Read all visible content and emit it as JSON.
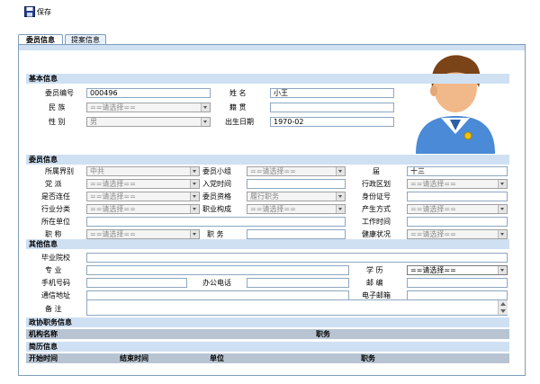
{
  "toolbar": {
    "save_label": "保存"
  },
  "tabs": [
    {
      "label": "委员信息"
    },
    {
      "label": "提案信息"
    }
  ],
  "basic": {
    "title": "基本信息",
    "member_no_label": "委员编号",
    "member_no": "000496",
    "name_label": "姓    名",
    "name": "小王",
    "ethnicity_label": "民    族",
    "ethnicity": "==请选择==",
    "native_label": "籍    贯",
    "native": "",
    "gender_label": "性    别",
    "gender": "男",
    "birth_label": "出生日期",
    "birth": "1970-02"
  },
  "member": {
    "title": "委员信息",
    "sector_label": "所属界别",
    "sector": "中共",
    "group_label": "委员小组",
    "group": "==请选择==",
    "session_label": "届",
    "session": "十三",
    "party_label": "党    派",
    "party": "==请选择==",
    "join_label": "入党时间",
    "join": "",
    "district_label": "行政区划",
    "district": "==请选择==",
    "reappoint_label": "是否连任",
    "reappoint": "==请选择==",
    "qual_label": "委员资格",
    "qual": "履行职务",
    "id_label": "身份证号",
    "id": "",
    "industry_label": "行业分类",
    "industry": "==请选择==",
    "struct_label": "职业构成",
    "struct": "==请选择==",
    "produce_label": "产生方式",
    "produce": "==请选择==",
    "unit_label": "所在单位",
    "unit": "",
    "worktime_label": "工作时间",
    "worktime": "",
    "title_label": "职    称",
    "title_value": "==请选择==",
    "post_label": "职    务",
    "post": "",
    "health_label": "健康状况",
    "health": "==请选择=="
  },
  "other": {
    "title": "其他信息",
    "school_label": "毕业院校",
    "school": "",
    "major_label": "专    业",
    "major": "",
    "edu_label": "学    历",
    "edu": "==请选择==",
    "mobile_label": "手机号码",
    "mobile": "",
    "office_label": "办公电话",
    "office": "",
    "zip_label": "邮    编",
    "zip": "",
    "addr_label": "通信地址",
    "addr": "",
    "email_label": "电子邮箱",
    "email": "",
    "remark_label": "备    注",
    "remark": ""
  },
  "cppcc": {
    "title": "政协职务信息",
    "col1": "机构名称",
    "col2": "职务"
  },
  "resume": {
    "title": "简历信息",
    "col1": "开始时间",
    "col2": "结束时间",
    "col3": "单位",
    "col4": "职务"
  },
  "icons": {
    "save": "floppy-disk-icon",
    "avatar": "user-avatar-icon"
  },
  "colors": {
    "section": "#cfe0f3",
    "frame": "#7f9db9",
    "tab_active": "#e8f0fa"
  }
}
